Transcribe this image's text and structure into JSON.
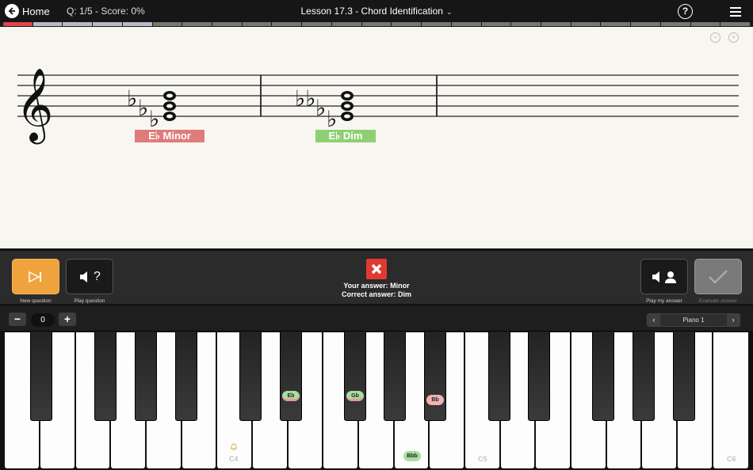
{
  "topbar": {
    "home_label": "Home",
    "question_score": "Q: 1/5 - Score: 0%",
    "lesson_title": "Lesson 17.3 - Chord Identification",
    "help_icon_text": "?",
    "icons": [
      "back-arrow-icon",
      "chevron-down-icon",
      "help-icon",
      "hamburger-menu-icon"
    ]
  },
  "progress": {
    "questions": 5,
    "current": 1
  },
  "score": {
    "chords": [
      {
        "label": "E♭ Minor",
        "status": "incorrect",
        "color": "#e07b7b"
      },
      {
        "label": "E♭ Dim",
        "status": "correct",
        "color": "#8fcf74"
      }
    ],
    "icons": [
      "zoom-out-icon",
      "zoom-in-icon"
    ]
  },
  "controls": {
    "new_question_label": "New question",
    "play_question_label": "Play question",
    "play_question_glyph": "?",
    "play_answer_label": "Play my answer",
    "evaluate_label": "Evaluate answer",
    "your_answer": "Your answer: Minor",
    "correct_answer": "Correct answer: Dim",
    "colors": {
      "primary": "#efa33c",
      "wrong": "#e03a30"
    }
  },
  "keyboard_bar": {
    "minus": "−",
    "octave_value": "0",
    "plus": "+",
    "instrument": "Piano 1",
    "prev": "‹",
    "next": "›"
  },
  "piano": {
    "labels": {
      "c4": "C4",
      "c5": "C5",
      "c6": "C6"
    },
    "notes": {
      "eb": "Eb",
      "gb": "Gb",
      "bb": "Bb",
      "bbb": "Bbb"
    },
    "note_colors": {
      "correct": "#a8dfa0",
      "wrong": "#f2b3b3"
    }
  }
}
